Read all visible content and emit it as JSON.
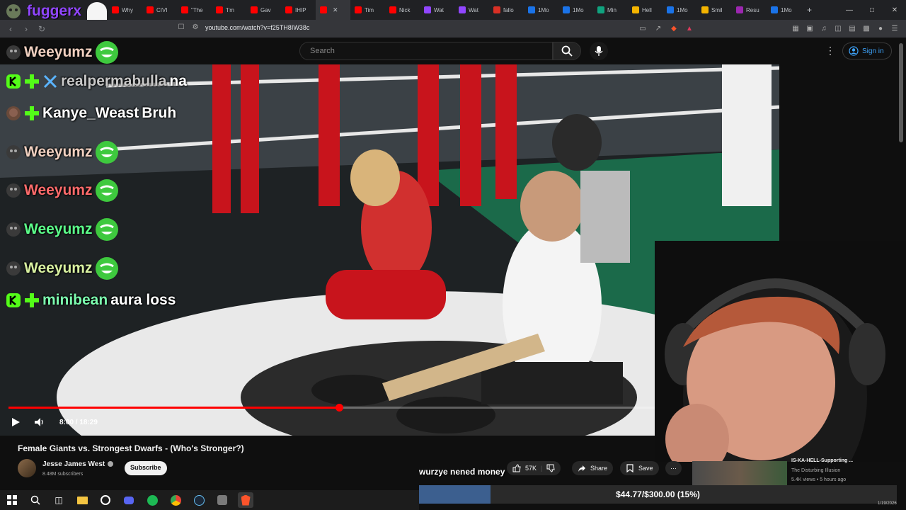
{
  "streamer_overlay": {
    "name": "fuggerx"
  },
  "browser": {
    "tabs": [
      {
        "label": "Why",
        "color": "#ff0000"
      },
      {
        "label": "CIVI",
        "color": "#ff0000"
      },
      {
        "label": "\"The",
        "color": "#ff0000"
      },
      {
        "label": "'I'm",
        "color": "#ff0000"
      },
      {
        "label": "Gav",
        "color": "#ff0000"
      },
      {
        "label": "IHIP",
        "color": "#ff0000"
      },
      {
        "label": "",
        "color": "#ff0000",
        "active": true
      },
      {
        "label": "Tim",
        "color": "#ff0000"
      },
      {
        "label": "Nick",
        "color": "#ff0000"
      },
      {
        "label": "Wat",
        "color": "#9146ff"
      },
      {
        "label": "Wat",
        "color": "#9146ff"
      },
      {
        "label": "fallo",
        "color": "#d93025"
      },
      {
        "label": "1Mo",
        "color": "#1a73e8"
      },
      {
        "label": "1Mo",
        "color": "#1a73e8"
      },
      {
        "label": "Min",
        "color": "#10a37f"
      },
      {
        "label": "Hell",
        "color": "#f4b400"
      },
      {
        "label": "1Mo",
        "color": "#1a73e8"
      },
      {
        "label": "Smil",
        "color": "#f4b400"
      },
      {
        "label": "Resu",
        "color": "#9c27b0"
      },
      {
        "label": "1Mo",
        "color": "#1a73e8"
      }
    ],
    "url": "youtube.com/watch?v=f25TH8IW38c"
  },
  "youtube": {
    "search_placeholder": "Search",
    "sign_in": "Sign in"
  },
  "chat": [
    {
      "user": "Weeyumz",
      "message": "",
      "color": "#f0d0c0",
      "badges": [
        "avatar"
      ],
      "emote": true
    },
    {
      "user": "realpermabulla",
      "message": "na",
      "color": "#c8c8c8",
      "badges": [
        "kick",
        "plus",
        "sword"
      ],
      "emote": false
    },
    {
      "user": "Kanye_Weast",
      "message": "Bruh",
      "color": "#ffffff",
      "badges": [
        "face",
        "plus"
      ],
      "emote": false
    },
    {
      "user": "Weeyumz",
      "message": "",
      "color": "#f0d0c0",
      "badges": [
        "avatar"
      ],
      "emote": true
    },
    {
      "user": "Weeyumz",
      "message": "",
      "color": "#ff6b6b",
      "badges": [
        "avatar"
      ],
      "emote": true
    },
    {
      "user": "Weeyumz",
      "message": "",
      "color": "#5cff8a",
      "badges": [
        "avatar"
      ],
      "emote": true
    },
    {
      "user": "Weeyumz",
      "message": "",
      "color": "#d8f0a0",
      "badges": [
        "avatar"
      ],
      "emote": true
    },
    {
      "user": "minibean",
      "message": "aura loss",
      "color": "#7dffb0",
      "badges": [
        "kick",
        "plus"
      ],
      "emote": false
    }
  ],
  "player": {
    "current_time": "8:00",
    "duration": "18:29",
    "time_display": "8:00 / 18:29",
    "progress_fraction": 0.4328
  },
  "video": {
    "title": "Female Giants vs. Strongest Dwarfs - (Who's Stronger?)",
    "channel": "Jesse James West",
    "subscribers": "8.48M subscribers",
    "subscribe_label": "Subscribe",
    "likes": "57K",
    "share_label": "Share",
    "save_label": "Save"
  },
  "overlay_message": "wurzye nened money",
  "recommended": {
    "title": "IS-KA-HELL-Supporting ...",
    "channel": "The Disturbing Illusion",
    "meta": "5.4K views • 5 hours ago"
  },
  "donation_goal": {
    "text": "$44.77/$300.00 (15%)",
    "fraction": 0.15
  },
  "taskbar": {
    "date": "1/19/2026"
  }
}
